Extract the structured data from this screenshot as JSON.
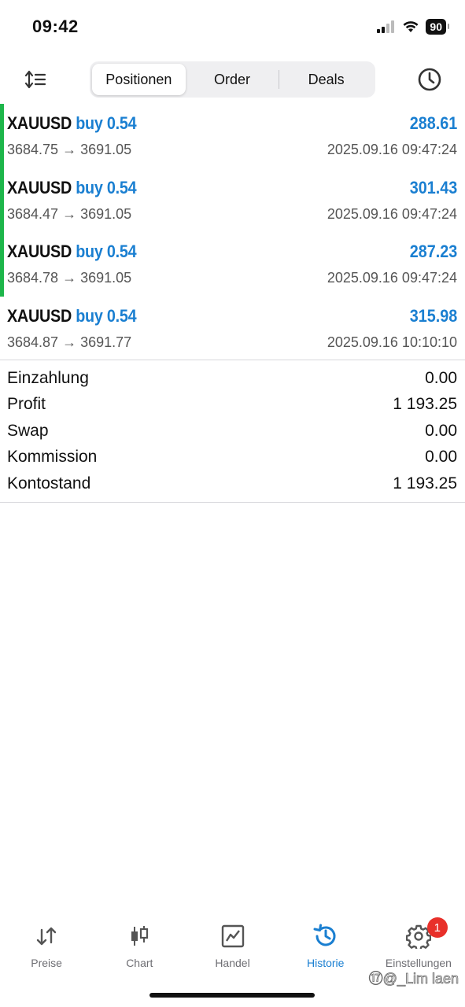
{
  "status_bar": {
    "time": "09:42",
    "battery": "90"
  },
  "toolbar": {
    "tabs": [
      {
        "label": "Positionen",
        "active": true
      },
      {
        "label": "Order",
        "active": false
      },
      {
        "label": "Deals",
        "active": false
      }
    ]
  },
  "positions": [
    {
      "symbol": "XAUUSD",
      "side_volume": "buy 0.54",
      "profit": "288.61",
      "prices": "3684.75 → 3691.05",
      "time": "2025.09.16 09:47:24",
      "highlight": true
    },
    {
      "symbol": "XAUUSD",
      "side_volume": "buy 0.54",
      "profit": "301.43",
      "prices": "3684.47 → 3691.05",
      "time": "2025.09.16 09:47:24",
      "highlight": true
    },
    {
      "symbol": "XAUUSD",
      "side_volume": "buy 0.54",
      "profit": "287.23",
      "prices": "3684.78 → 3691.05",
      "time": "2025.09.16 09:47:24",
      "highlight": true
    },
    {
      "symbol": "XAUUSD",
      "side_volume": "buy 0.54",
      "profit": "315.98",
      "prices": "3684.87 → 3691.77",
      "time": "2025.09.16 10:10:10",
      "highlight": false
    }
  ],
  "summary": [
    {
      "label": "Einzahlung",
      "value": "0.00"
    },
    {
      "label": "Profit",
      "value": "1 193.25"
    },
    {
      "label": "Swap",
      "value": "0.00"
    },
    {
      "label": "Kommission",
      "value": "0.00"
    },
    {
      "label": "Kontostand",
      "value": "1 193.25"
    }
  ],
  "tabbar": {
    "items": [
      {
        "label": "Preise",
        "icon": "arrows-updown-icon",
        "active": false
      },
      {
        "label": "Chart",
        "icon": "candlestick-icon",
        "active": false
      },
      {
        "label": "Handel",
        "icon": "trade-chart-icon",
        "active": false
      },
      {
        "label": "Historie",
        "icon": "history-icon",
        "active": true
      },
      {
        "label": "Einstellungen",
        "icon": "gear-icon",
        "active": false
      }
    ],
    "settings_badge": "1"
  },
  "watermark": "⑰@_Lim laen",
  "colors": {
    "accent_blue": "#1a7fd1",
    "highlight_green": "#1db64a",
    "badge_red": "#e8302a"
  }
}
